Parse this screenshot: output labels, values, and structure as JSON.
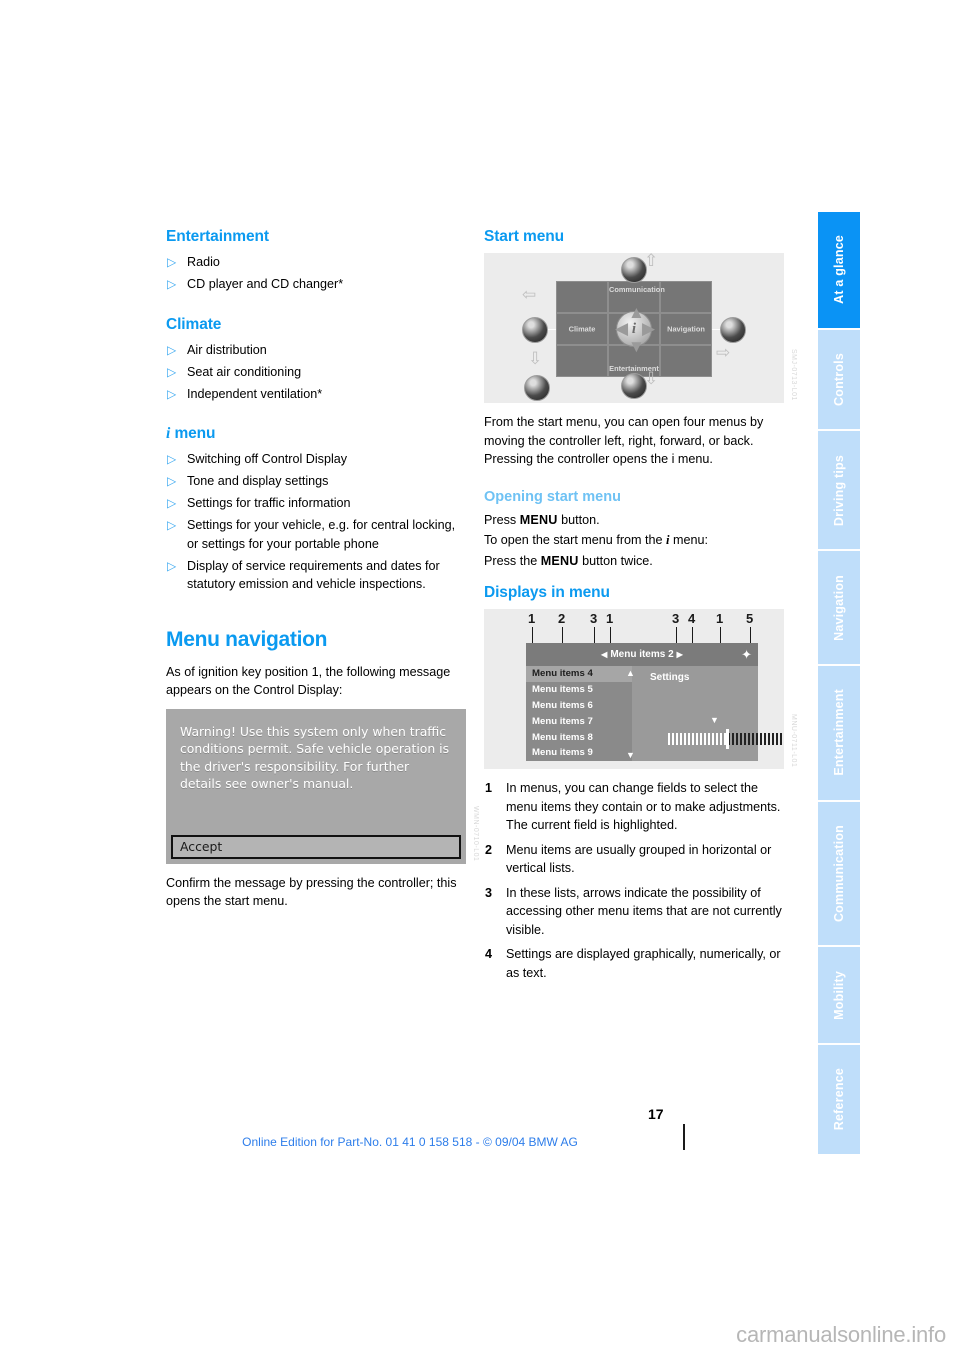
{
  "sidebar": {
    "tabs": [
      {
        "label": "At a glance",
        "active": true
      },
      {
        "label": "Controls",
        "active": false
      },
      {
        "label": "Driving tips",
        "active": false
      },
      {
        "label": "Navigation",
        "active": false
      },
      {
        "label": "Entertainment",
        "active": false
      },
      {
        "label": "Communication",
        "active": false
      },
      {
        "label": "Mobility",
        "active": false
      },
      {
        "label": "Reference",
        "active": false
      }
    ],
    "active_color": "#0a93f5",
    "inactive_color": "#bfdefa"
  },
  "left_column": {
    "entertainment": {
      "heading": "Entertainment",
      "items": [
        "Radio",
        "CD player and CD changer*"
      ]
    },
    "climate": {
      "heading": "Climate",
      "items": [
        "Air distribution",
        "Seat air conditioning",
        "Independent ventilation*"
      ]
    },
    "imenu": {
      "heading_icon": "i",
      "heading": "menu",
      "items": [
        "Switching off Control Display",
        "Tone and display settings",
        "Settings for traffic information",
        "Settings for your vehicle, e.g. for central locking, or settings for your portable phone",
        "Display of service requirements and dates for statutory emission and vehicle inspections."
      ]
    },
    "menu_navigation": {
      "heading": "Menu navigation",
      "intro": "As of ignition key position 1, the following message appears on the Control Display:",
      "warning_display": {
        "message": "Warning! Use this system only when traffic conditions permit. Safe vehicle operation is the driver's responsibility. For further details see owner's manual.",
        "button_label": "Accept",
        "figure_code": "WMN-0710-L01"
      },
      "outro": "Confirm the message by pressing the controller; this opens the start menu."
    }
  },
  "right_column": {
    "start_menu": {
      "heading": "Start menu",
      "figure": {
        "code": "SMJ-0713-L01",
        "center_label": "i",
        "quadrants": {
          "top": "Communication",
          "left": "Climate",
          "right": "Navigation",
          "bottom": "Entertainment"
        }
      },
      "body": "From the start menu, you can open four menus by moving the controller left, right, forward, or back. Pressing the controller opens the i menu."
    },
    "opening_start_menu": {
      "heading": "Opening start menu",
      "line1_pre": "Press ",
      "line1_btn": "MENU",
      "line1_post": " button.",
      "line2_pre": "To open the start menu from the ",
      "line2_icon": "i",
      "line2_post": " menu:",
      "line3_pre": "Press the ",
      "line3_btn": "MENU",
      "line3_post": " button twice."
    },
    "displays_in_menu": {
      "heading": "Displays in menu",
      "figure": {
        "code": "MNU-0711-L01",
        "title": "Menu items 2",
        "settings_label": "Settings",
        "list_items": [
          "Menu items 4",
          "Menu items 5",
          "Menu items 6",
          "Menu items 7",
          "Menu items 8",
          "Menu items 9"
        ],
        "highlighted_index": 0,
        "callouts": [
          "1",
          "2",
          "3",
          "1",
          "3",
          "4",
          "1",
          "5"
        ]
      },
      "numbered_notes": [
        {
          "num": "1",
          "text": "In menus, you can change fields to select the menu items they contain or to make adjustments. The current field is highlighted."
        },
        {
          "num": "2",
          "text": "Menu items are usually grouped in horizontal or vertical lists."
        },
        {
          "num": "3",
          "text": "In these lists, arrows indicate the possibility of accessing other menu items that are not currently visible."
        },
        {
          "num": "4",
          "text": "Settings are displayed graphically, numerically, or as text."
        }
      ]
    }
  },
  "footer": {
    "page_number": "17",
    "note": "Online Edition for Part-No. 01 41 0 158 518 - © 09/04 BMW AG",
    "watermark": "carmanualsonline.info"
  }
}
